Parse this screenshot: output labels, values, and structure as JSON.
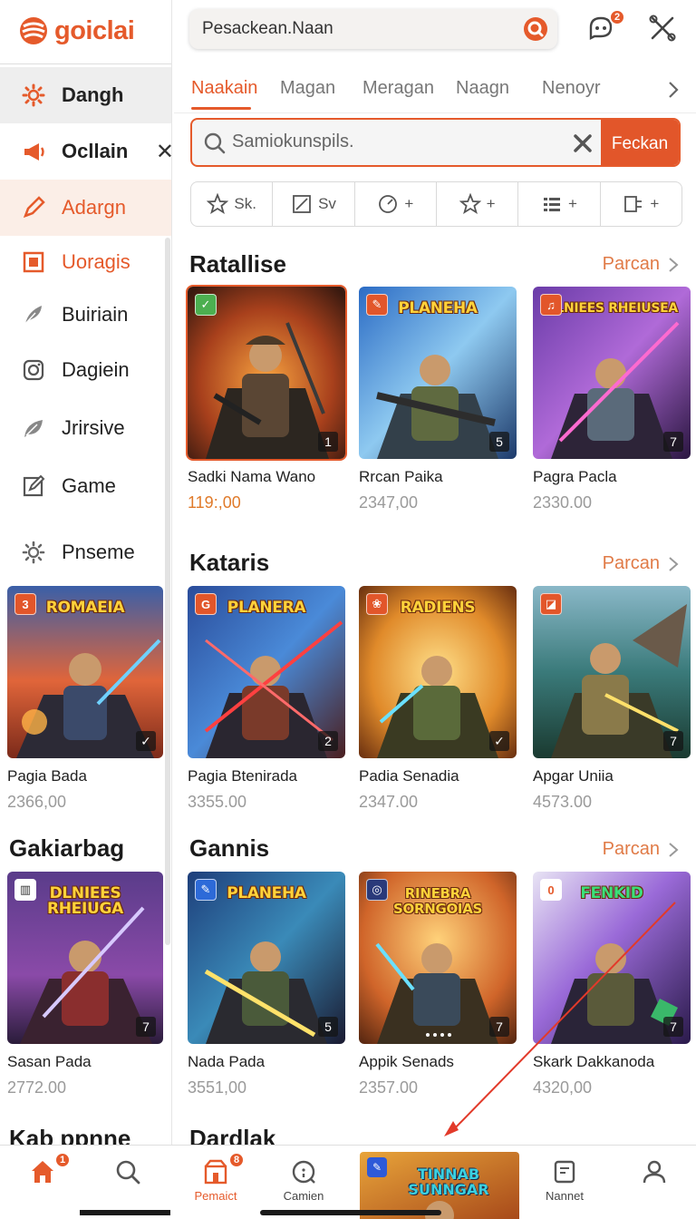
{
  "app": {
    "logo_text": "goiclai"
  },
  "drawer": {
    "items": [
      {
        "label": "Dangh",
        "icon": "gear-icon"
      },
      {
        "label": "Ocllain",
        "icon": "megaphone-icon"
      },
      {
        "label": "Adargn",
        "icon": "pen-icon"
      },
      {
        "label": "Uoragis",
        "icon": "square-icon"
      },
      {
        "label": "Buiriain",
        "icon": "feather-icon"
      },
      {
        "label": "Dagiein",
        "icon": "camera-icon"
      },
      {
        "label": "Jrirsive",
        "icon": "leaf-icon"
      },
      {
        "label": "Game",
        "icon": "edit-icon"
      },
      {
        "label": "Pnseme",
        "icon": "gear-icon"
      }
    ],
    "close_symbol": "✕"
  },
  "header": {
    "search_placeholder": "Pesackean.Naan",
    "notification_count": "2"
  },
  "tabs": [
    "Naakain",
    "Magan",
    "Meragan",
    "Naagn",
    "Nenoyr"
  ],
  "filter": {
    "placeholder": "Samiokunspils.",
    "button_label": "Feckan"
  },
  "chips": [
    "Sk.",
    "Sv",
    "+",
    "+",
    "+",
    "+"
  ],
  "sections": [
    {
      "title": "Ratallise",
      "more": "Parcan",
      "cards": [
        {
          "name": "Sadki Nama Wano",
          "price": "119:,00",
          "count": "1",
          "art_title": "",
          "palette": "fire"
        },
        {
          "name": "Rrcan Paika",
          "price": "2347,00",
          "count": "5",
          "art_title": "PLANEHA",
          "palette": "blue"
        },
        {
          "name": "Pagra Pacla",
          "price": "2330.00",
          "count": "7",
          "art_title": "DLNIEES RHEIUSEA",
          "palette": "purple"
        }
      ]
    },
    {
      "title": "Kataris",
      "more": "Parcan",
      "cards": [
        {
          "name": "Pagia Bada",
          "price": "2366,00",
          "count": "✓",
          "art_title": "ROMAEIA",
          "palette": "sunset"
        },
        {
          "name": "Pagia Btenirada",
          "price": "3355.00",
          "count": "2",
          "art_title": "PLANERA",
          "palette": "blue"
        },
        {
          "name": "Padia Senadia",
          "price": "2347.00",
          "count": "✓",
          "art_title": "RADIENS",
          "palette": "gold"
        },
        {
          "name": "Apgar Uniia",
          "price": "4573.00",
          "count": "7",
          "art_title": "",
          "palette": "teal"
        }
      ]
    },
    {
      "title": "Gannis",
      "left_title": "Gakiarbag",
      "more": "Parcan",
      "cards": [
        {
          "name": "Sasan Pada",
          "price": "2772.00",
          "count": "7",
          "art_title": "DLNIEES RHEIUGA",
          "palette": "purple"
        },
        {
          "name": "Nada Pada",
          "price": "3551,00",
          "count": "5",
          "art_title": "PLANEHA",
          "palette": "blue"
        },
        {
          "name": "Appik Senads",
          "price": "2357.00",
          "count": "7",
          "art_title": "RINEBRA SORNGOIAS",
          "palette": "sunset"
        },
        {
          "name": "Skark Dakkanoda",
          "price": "4320,00",
          "count": "7",
          "art_title": "FENKID",
          "palette": "violet"
        }
      ]
    }
  ],
  "partial_titles": {
    "left": "Kab ppnne",
    "right": "Dardlak"
  },
  "bottom_nav": [
    {
      "label": "",
      "icon": "home-icon",
      "badge": "1"
    },
    {
      "label": "",
      "icon": "search-icon"
    },
    {
      "label": "Pemaict",
      "icon": "shop-icon",
      "badge": "8"
    },
    {
      "label": "Camien",
      "icon": "explore-icon"
    },
    {
      "label": "Nannet",
      "icon": "document-icon"
    },
    {
      "label": "",
      "icon": "profile-icon"
    }
  ],
  "promo_title": "TINNAB SUNNGAR"
}
